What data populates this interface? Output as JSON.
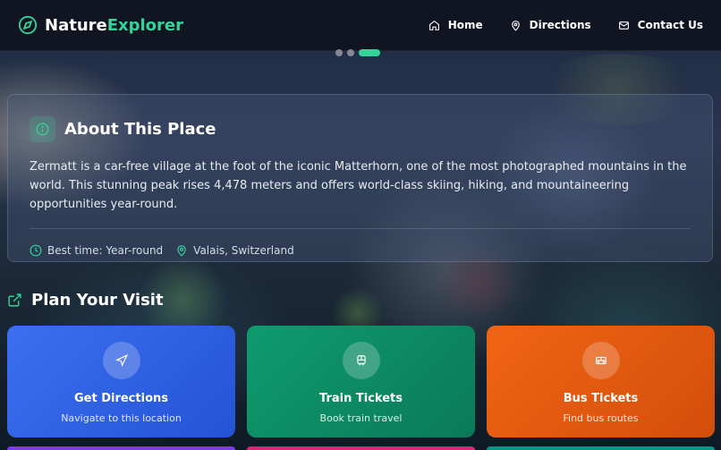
{
  "brand": {
    "name_a": "Nature",
    "name_b": "Explorer",
    "accent": "#34d399",
    "icon": "compass-icon"
  },
  "nav": [
    {
      "label": "Home",
      "icon": "home-icon"
    },
    {
      "label": "Directions",
      "icon": "map-pin-icon"
    },
    {
      "label": "Contact Us",
      "icon": "mail-icon"
    }
  ],
  "carousel": {
    "slides": 3,
    "active": 2
  },
  "about": {
    "title": "About This Place",
    "text": "Zermatt is a car-free village at the foot of the iconic Matterhorn, one of the most photographed mountains in the world. This stunning peak rises 4,478 meters and offers world-class skiing, hiking, and mountaineering opportunities year-round.",
    "best_time": "Best time: Year-round",
    "location": "Valais, Switzerland"
  },
  "plan": {
    "title": "Plan Your Visit",
    "cards": [
      {
        "title": "Get Directions",
        "subtitle": "Navigate to this location",
        "icon": "navigation-icon",
        "color": "#2f62e6"
      },
      {
        "title": "Train Tickets",
        "subtitle": "Book train travel",
        "icon": "train-icon",
        "color": "#0d8a62"
      },
      {
        "title": "Bus Tickets",
        "subtitle": "Find bus routes",
        "icon": "bus-icon",
        "color": "#e55a10"
      }
    ]
  }
}
